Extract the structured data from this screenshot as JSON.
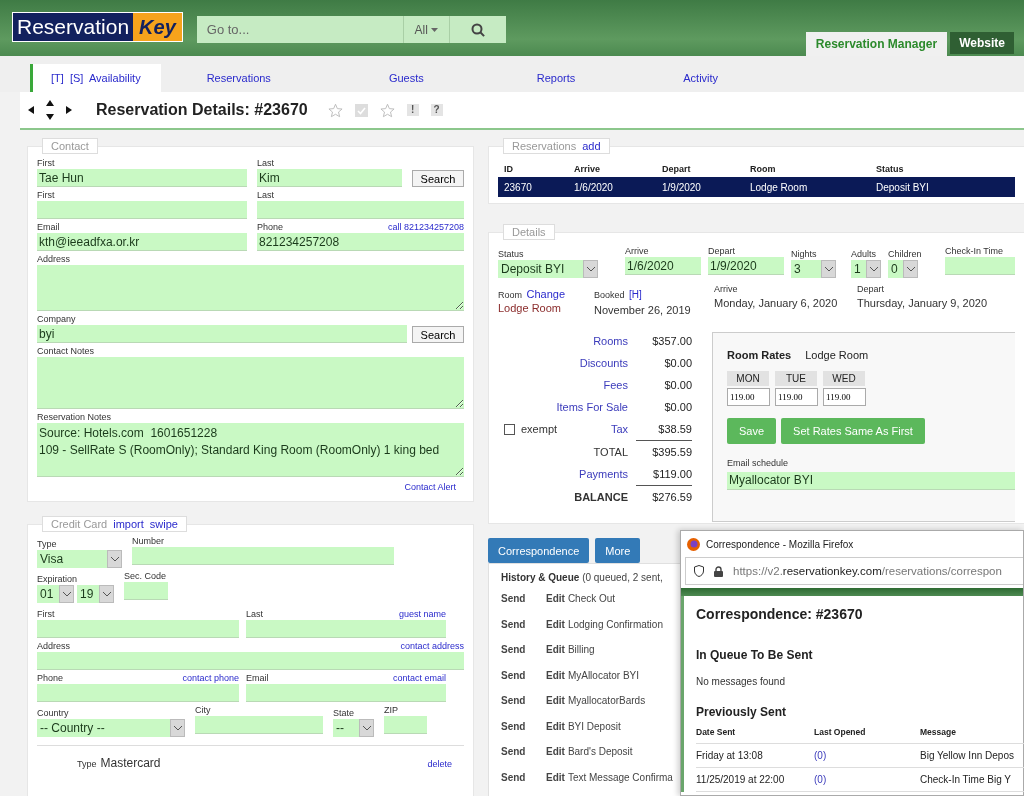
{
  "header": {
    "logo": {
      "main": "Reservation",
      "accent": "Key"
    },
    "search": {
      "placeholder": "Go to...",
      "scope": "All"
    },
    "tabs": [
      {
        "label": "Reservation Manager",
        "selected": true
      },
      {
        "label": "Website",
        "selected": false
      }
    ]
  },
  "nav": [
    {
      "label": "[T]  [S]  Availability",
      "selected": true
    },
    {
      "label": "Reservations",
      "selected": false
    },
    {
      "label": "Guests",
      "selected": false
    },
    {
      "label": "Reports",
      "selected": false
    },
    {
      "label": "Activity",
      "selected": false
    }
  ],
  "title_bar": {
    "title": "Reservation Details: #23670",
    "icons": [
      {
        "kind": "star"
      },
      {
        "kind": "check"
      },
      {
        "kind": "star"
      },
      {
        "kind": "mark",
        "text": "!"
      },
      {
        "kind": "mark",
        "text": "?"
      }
    ]
  },
  "contact": {
    "legend": "Contact",
    "name": {
      "first": {
        "label": "First",
        "value": "Tae Hun"
      },
      "last": {
        "label": "Last",
        "value": "Kim"
      },
      "button": "Search"
    },
    "name2": {
      "first": {
        "label": "First"
      },
      "last": {
        "label": "Last"
      }
    },
    "email": {
      "label": "Email",
      "value": "kth@ieeadfxa.or.kr"
    },
    "phone": {
      "label": "Phone",
      "value": "821234257208",
      "link": "call 821234257208"
    },
    "address": {
      "label": "Address"
    },
    "company": {
      "label": "Company",
      "value": "byi",
      "button": "Search"
    },
    "contact_notes": {
      "label": "Contact Notes"
    },
    "reservation_notes": {
      "label": "Reservation Notes",
      "value": "Source: Hotels.com  1601651228\n109 - SellRate S (RoomOnly); Standard King Room (RoomOnly) 1 king bed"
    },
    "alert_link": "Contact Alert"
  },
  "credit_card": {
    "legend": "Credit Card",
    "links": [
      "import",
      "swipe"
    ],
    "type": {
      "label": "Type",
      "value": "Visa"
    },
    "number": {
      "label": "Number"
    },
    "expiration": {
      "label": "Expiration",
      "month": "01",
      "year": "19"
    },
    "sec_code": {
      "label": "Sec. Code"
    },
    "first": {
      "label": "First"
    },
    "last": {
      "label": "Last",
      "link": "guest name"
    },
    "address": {
      "label": "Address",
      "link": "contact address"
    },
    "phone": {
      "label": "Phone",
      "link": "contact phone"
    },
    "email": {
      "label": "Email",
      "link": "contact email"
    },
    "country": {
      "label": "Country",
      "value": "-- Country --"
    },
    "city": {
      "label": "City"
    },
    "state": {
      "label": "State",
      "value": "--"
    },
    "zip": {
      "label": "ZIP"
    },
    "saved_card": {
      "type_label": "Type",
      "type_value": "Mastercard",
      "delete_link": "delete"
    }
  },
  "reservations": {
    "legend": "Reservations",
    "add_link": "add",
    "columns": [
      "ID",
      "Arrive",
      "Depart",
      "Room",
      "Status"
    ],
    "rows": [
      {
        "cells": [
          "23670",
          "1/6/2020",
          "1/9/2020",
          "Lodge Room",
          "Deposit BYI"
        ],
        "selected": true
      }
    ]
  },
  "details": {
    "legend": "Details",
    "status": {
      "label": "Status",
      "value": "Deposit BYI"
    },
    "arrive": {
      "label": "Arrive",
      "value": "1/6/2020"
    },
    "depart": {
      "label": "Depart",
      "value": "1/9/2020"
    },
    "nights": {
      "label": "Nights",
      "value": "3"
    },
    "adults": {
      "label": "Adults",
      "value": "1"
    },
    "children": {
      "label": "Children",
      "value": "0"
    },
    "checkin": {
      "label": "Check-In Time"
    },
    "room": {
      "label": "Room",
      "link": "Change",
      "value": "Lodge Room"
    },
    "booked": {
      "label": "Booked",
      "link": "[H]",
      "value": "November 26, 2019"
    },
    "arrive_long": {
      "label": "Arrive",
      "value": "Monday, January 6, 2020"
    },
    "depart_long": {
      "label": "Depart",
      "value": "Thursday, January 9, 2020"
    },
    "totals": [
      {
        "kind": "link",
        "label": "Rooms",
        "amount": "$357.00"
      },
      {
        "kind": "link",
        "label": "Discounts",
        "amount": "$0.00"
      },
      {
        "kind": "link",
        "label": "Fees",
        "amount": "$0.00"
      },
      {
        "kind": "link",
        "label": "Items For Sale",
        "amount": "$0.00"
      },
      {
        "kind": "tax",
        "label": "Tax",
        "amount": "$38.59",
        "exempt": {
          "label": "exempt",
          "checked": false
        }
      },
      {
        "kind": "total",
        "label": "TOTAL",
        "amount": "$395.59"
      },
      {
        "kind": "link",
        "label": "Payments",
        "amount": "$119.00"
      },
      {
        "kind": "balance",
        "label": "BALANCE",
        "amount": "$276.59"
      }
    ],
    "room_rates": {
      "title": "Room Rates",
      "room": "Lodge Room",
      "days": [
        {
          "day": "MON",
          "rate": "119.00"
        },
        {
          "day": "TUE",
          "rate": "119.00"
        },
        {
          "day": "WED",
          "rate": "119.00"
        }
      ],
      "buttons": [
        "Save",
        "Set Rates Same As First"
      ],
      "email_schedule": {
        "label": "Email schedule",
        "value": "Myallocator BYI"
      }
    }
  },
  "correspondence": {
    "buttons": [
      "Correspondence",
      "More"
    ],
    "heading": "History & Queue",
    "summary": "(0 queued, 2 sent,",
    "rows": [
      {
        "send": "Send",
        "edit": "Edit",
        "name": "Check Out"
      },
      {
        "send": "Send",
        "edit": "Edit",
        "name": "Lodging Confirmation"
      },
      {
        "send": "Send",
        "edit": "Edit",
        "name": "Billing"
      },
      {
        "send": "Send",
        "edit": "Edit",
        "name": "MyAllocator BYI"
      },
      {
        "send": "Send",
        "edit": "Edit",
        "name": "MyallocatorBards"
      },
      {
        "send": "Send",
        "edit": "Edit",
        "name": "BYI Deposit"
      },
      {
        "send": "Send",
        "edit": "Edit",
        "name": "Bard's Deposit"
      },
      {
        "send": "Send",
        "edit": "Edit",
        "name": "Text Message Confirma"
      }
    ]
  },
  "popup": {
    "window_title": "Correspondence - Mozilla Firefox",
    "url": "https://v2.**reservationkey.com**/reservations/correspon",
    "heading": "Correspondence: #23670",
    "queue_heading": "In Queue To Be Sent",
    "queue_empty": "No messages found",
    "sent_heading": "Previously Sent",
    "columns": [
      "Date Sent",
      "Last Opened",
      "Message"
    ],
    "rows": [
      [
        "Friday at 13:08",
        "(0)",
        "Big Yellow Inn Depos"
      ],
      [
        "11/25/2019 at 22:00",
        "(0)",
        "Check-In Time Big Y"
      ]
    ]
  }
}
